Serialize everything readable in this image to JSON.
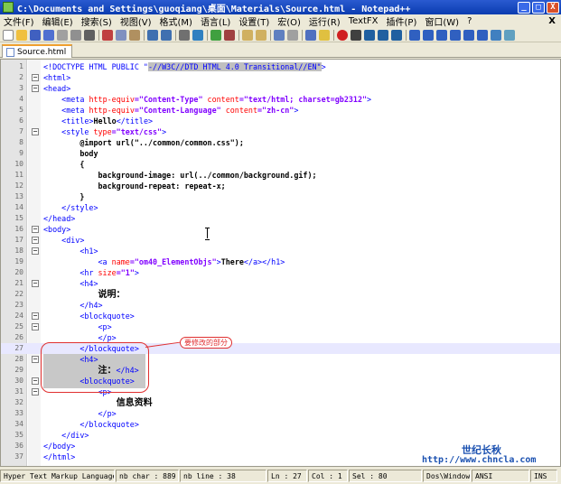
{
  "window": {
    "title": "C:\\Documents and Settings\\guoqiang\\桌面\\Materials\\Source.html - Notepad++",
    "buttons": {
      "minimize": "_",
      "maximize": "□",
      "close": "X"
    }
  },
  "menu": [
    "文件(F)",
    "编辑(E)",
    "搜索(S)",
    "视图(V)",
    "格式(M)",
    "语言(L)",
    "设置(T)",
    "宏(O)",
    "运行(R)",
    "TextFX",
    "插件(P)",
    "窗口(W)",
    "?"
  ],
  "menu_close": "X",
  "tab": {
    "label": "Source.html"
  },
  "lines": [
    {
      "n": "1"
    },
    {
      "n": "2"
    },
    {
      "n": "3"
    },
    {
      "n": "4"
    },
    {
      "n": "5"
    },
    {
      "n": "6"
    },
    {
      "n": "7"
    },
    {
      "n": "8"
    },
    {
      "n": "9"
    },
    {
      "n": "10"
    },
    {
      "n": "11"
    },
    {
      "n": "12"
    },
    {
      "n": "13"
    },
    {
      "n": "14"
    },
    {
      "n": "15"
    },
    {
      "n": "16"
    },
    {
      "n": "17"
    },
    {
      "n": "18"
    },
    {
      "n": "19"
    },
    {
      "n": "20"
    },
    {
      "n": "21"
    },
    {
      "n": "22"
    },
    {
      "n": "23"
    },
    {
      "n": "24"
    },
    {
      "n": "25"
    },
    {
      "n": "26"
    },
    {
      "n": "27"
    },
    {
      "n": "28"
    },
    {
      "n": "29"
    },
    {
      "n": "30"
    },
    {
      "n": "31"
    },
    {
      "n": "32"
    },
    {
      "n": "33"
    },
    {
      "n": "34"
    },
    {
      "n": "35"
    },
    {
      "n": "36"
    },
    {
      "n": "37"
    }
  ],
  "code": {
    "l1a": "<!DOCTYPE HTML PUBLIC \"",
    "l1b": "-//W3C//DTD HTML 4.0 Transitional//EN\"",
    "l1c": ">",
    "l2": "<html>",
    "l3": "<head>",
    "l4_tag": "<meta ",
    "l4_a1": "http-equiv",
    "l4_v1": "=\"Content-Type\" ",
    "l4_a2": "content",
    "l4_v2": "=\"text/html; charset=gb2312\"",
    "l4_end": ">",
    "l5_tag": "<meta ",
    "l5_a1": "http-equiv",
    "l5_v1": "=\"Content-Language\" ",
    "l5_a2": "content",
    "l5_v2": "=\"zh-cn\"",
    "l5_end": ">",
    "l6a": "<title>",
    "l6b": "Hello",
    "l6c": "</title>",
    "l7_tag": "<style ",
    "l7_a": "type",
    "l7_v": "=\"text/css\"",
    "l7_end": ">",
    "l8": "@import url(\"../common/common.css\");",
    "l9": "body",
    "l10": "{",
    "l11": "background-image: url(../common/background.gif);",
    "l12": "background-repeat: repeat-x;",
    "l13": "}",
    "l14": "</style>",
    "l15": "</head>",
    "l16": "<body>",
    "l17": "<div>",
    "l18": "<h1>",
    "l19_tag": "<a ",
    "l19_a": "name",
    "l19_v": "=\"om40_ElementObjs\"",
    "l19_mid": ">",
    "l19_text": "There",
    "l19_end": "</a></h1>",
    "l20_tag": "<hr ",
    "l20_a": "size",
    "l20_v": "=\"1\"",
    "l20_end": ">",
    "l21": "<h4>",
    "l22": "说明：",
    "l23": "</h4>",
    "l24": "<blockquote>",
    "l25": "<p>",
    "l26": "</p>",
    "l27": "</blockquote>",
    "l28": "<h4>",
    "l29a": "注：",
    "l29b": "</h4>",
    "l30": "<blockquote>",
    "l31": "<p>",
    "l32": "信息资料",
    "l33": "</p>",
    "l34": "</blockquote>",
    "l35": "</div>",
    "l36": "</body>",
    "l37": "</html>"
  },
  "callout": "要修改的部分",
  "watermark": {
    "line1": "世纪长秋",
    "line2": "http://www.chncla.com"
  },
  "status": {
    "lang": "Hyper Text Markup Language file",
    "chars": "nb char : 889",
    "lines": "nb line : 38",
    "ln": "Ln : 27",
    "col": "Col : 1",
    "sel": "Sel : 80",
    "eol": "Dos\\Windows",
    "enc": "ANSI",
    "ins": "INS"
  },
  "colors": {
    "tag": "#0000ff",
    "attr": "#ff0000",
    "value": "#8000ff",
    "callout": "#e03030",
    "watermark": "#1a50b0"
  }
}
